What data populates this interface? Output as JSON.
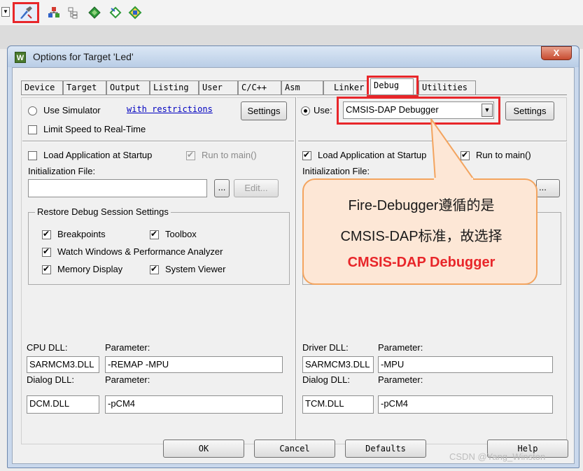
{
  "toolbar": {
    "icons": [
      "dropdown-arrow-icon",
      "options-for-target-icon",
      "manage-components-icon",
      "select-packs-icon",
      "green-diamond-icon",
      "diamond-arrow-icon",
      "pack-installer-icon"
    ]
  },
  "dialog": {
    "title": "Options for Target 'Led'",
    "close": "X",
    "tabs": [
      "Device",
      "Target",
      "Output",
      "Listing",
      "User",
      "C/C++",
      "Asm",
      "Linker",
      "Debug",
      "Utilities"
    ],
    "active_tab": "Debug"
  },
  "left": {
    "use_simulator": "Use Simulator",
    "with_restrictions": "with restrictions",
    "settings": "Settings",
    "limit_speed": "Limit Speed to Real-Time",
    "load_app": "Load Application at Startup",
    "run_to_main": "Run to main()",
    "init_file_label": "Initialization File:",
    "init_file_value": "",
    "browse": "...",
    "edit": "Edit...",
    "restore_group": "Restore Debug Session Settings",
    "breakpoints": "Breakpoints",
    "toolbox": "Toolbox",
    "watch_windows": "Watch Windows & Performance Analyzer",
    "memory_display": "Memory Display",
    "system_viewer": "System Viewer",
    "cpu_dll_label": "CPU DLL:",
    "cpu_param_label": "Parameter:",
    "cpu_dll_value": "SARMCM3.DLL",
    "cpu_param_value": "-REMAP -MPU",
    "dialog_dll_label": "Dialog DLL:",
    "dialog_param_label": "Parameter:",
    "dialog_dll_value": "DCM.DLL",
    "dialog_param_value": "-pCM4"
  },
  "right": {
    "use": "Use:",
    "debugger_value": "CMSIS-DAP Debugger",
    "settings": "Settings",
    "load_app": "Load Application at Startup",
    "run_to_main": "Run to main()",
    "init_file_label": "Initialization File:",
    "browse": "...",
    "driver_dll_label": "Driver DLL:",
    "driver_param_label": "Parameter:",
    "driver_dll_value": "SARMCM3.DLL",
    "driver_param_value": "-MPU",
    "dialog_dll_label": "Dialog DLL:",
    "dialog_param_label": "Parameter:",
    "dialog_dll_value": "TCM.DLL",
    "dialog_param_value": "-pCM4"
  },
  "callout": {
    "line1": "Fire-Debugger遵循的是",
    "line2": "CMSIS-DAP标准，故选择",
    "line3": "CMSIS-DAP Debugger"
  },
  "footer": {
    "ok": "OK",
    "cancel": "Cancel",
    "defaults": "Defaults",
    "help": "Help"
  },
  "watermark": "CSDN @Yang_Winston",
  "colors": {
    "highlight_red": "#e8262a",
    "callout_fill": "#fde7d6",
    "callout_border": "#f3a45f",
    "link_blue": "#0000c0"
  }
}
